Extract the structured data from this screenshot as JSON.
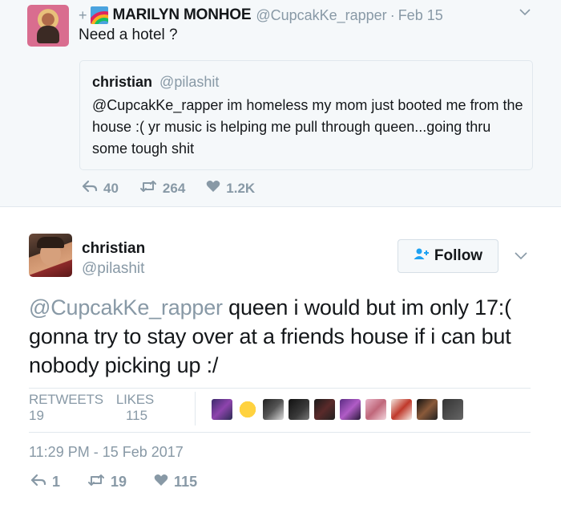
{
  "parent_tweet": {
    "plus_glyph": "+",
    "author_name": "MARILYN MONHOE",
    "author_handle": "@CupcakKe_rapper",
    "separator": "·",
    "date": "Feb 15",
    "text": "Need a hotel ?",
    "quoted": {
      "author_name": "christian",
      "author_handle": "@pilashit",
      "text": "@CupcakKe_rapper im homeless my mom just booted me from the house :( yr music is helping me pull through queen...going thru some tough shit"
    },
    "actions": {
      "replies": "40",
      "retweets": "264",
      "likes": "1.2K"
    }
  },
  "main_tweet": {
    "author_name": "christian",
    "author_handle": "@pilashit",
    "follow_label": "Follow",
    "mention": "@CupcakKe_rapper",
    "text": " queen i would but im only 17:( gonna try to stay over at a friends house if i can but nobody picking up :/",
    "stats": {
      "retweets_label": "RETWEETS",
      "retweets_value": "19",
      "likes_label": "LIKES",
      "likes_value": "115"
    },
    "liker_avatar_count": 10,
    "timestamp": "11:29 PM - 15 Feb 2017",
    "actions": {
      "replies": "1",
      "retweets": "19",
      "likes": "115"
    }
  },
  "icons": {
    "reply": "reply-icon",
    "retweet": "retweet-icon",
    "like": "heart-icon",
    "follow": "follow-user-icon",
    "menu": "chevron-down-icon",
    "rainbow": "rainbow-emoji-icon"
  },
  "colors": {
    "secondary_text": "#8899a6",
    "primary_text": "#14171a",
    "twitter_blue": "#1da1f2",
    "parent_background": "#f5f8fa"
  }
}
